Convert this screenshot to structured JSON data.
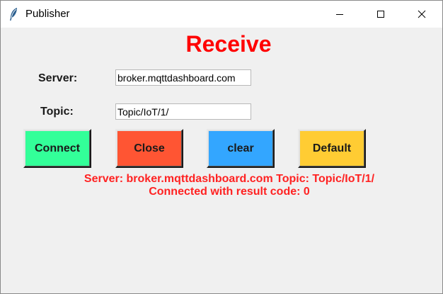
{
  "window": {
    "title": "Publisher",
    "app_icon": "feather-icon",
    "controls": {
      "minimize_icon": "minimize-icon",
      "maximize_icon": "maximize-icon",
      "close_icon": "close-icon"
    }
  },
  "main": {
    "heading": "Receive",
    "server_label": "Server:",
    "server_value": "broker.mqttdashboard.com",
    "topic_label": "Topic:",
    "topic_value": "Topic/IoT/1/",
    "buttons": {
      "connect": "Connect",
      "close": "Close",
      "clear": "clear",
      "default": "Default"
    },
    "status_line_1": "Server: broker.mqttdashboard.com Topic: Topic/IoT/1/",
    "status_line_2": "Connected with result code: 0"
  },
  "colors": {
    "heading": "#ff0000",
    "status": "#ff2222",
    "connect_button": "#33ff99",
    "close_button": "#ff5533",
    "clear_button": "#33a6ff",
    "default_button": "#ffcc33",
    "background": "#f0f0f0"
  }
}
